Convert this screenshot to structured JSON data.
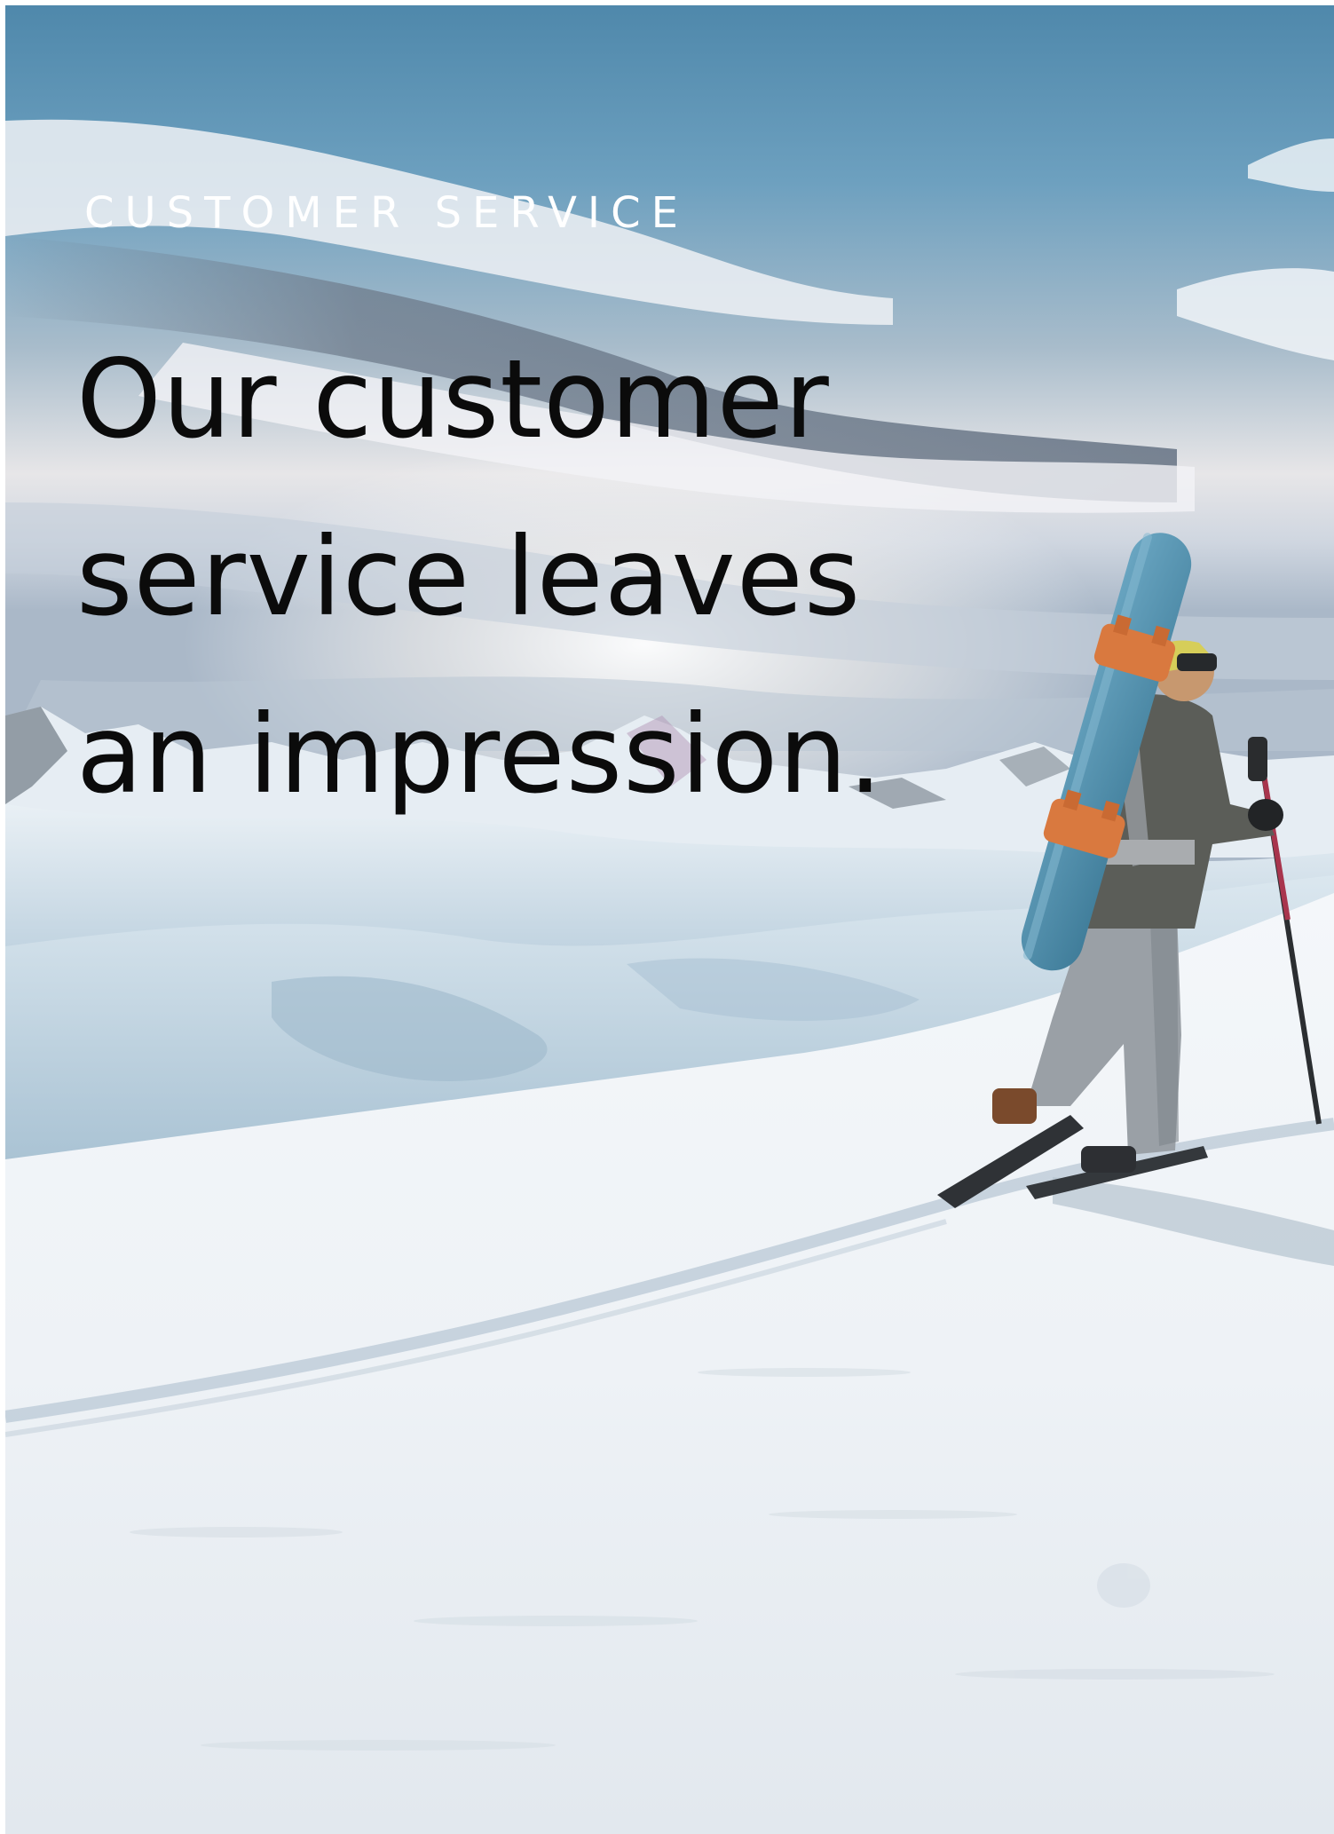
{
  "eyebrow": "CUSTOMER SERVICE",
  "headline": {
    "line1": "Our customer",
    "line2": "service leaves",
    "line3": "an impression."
  },
  "colors": {
    "eyebrow_text": "#ffffff",
    "headline_text": "#0b0b0b",
    "sky_top": "#5f97b8",
    "snow": "#eef3f7",
    "snowboard": "#5b97b4",
    "bindings": "#d9793f"
  },
  "photo": {
    "subject": "snowboarder-hiking-with-board-on-back",
    "scene": "snowy-mountain-slope-under-cloudy-sky"
  }
}
